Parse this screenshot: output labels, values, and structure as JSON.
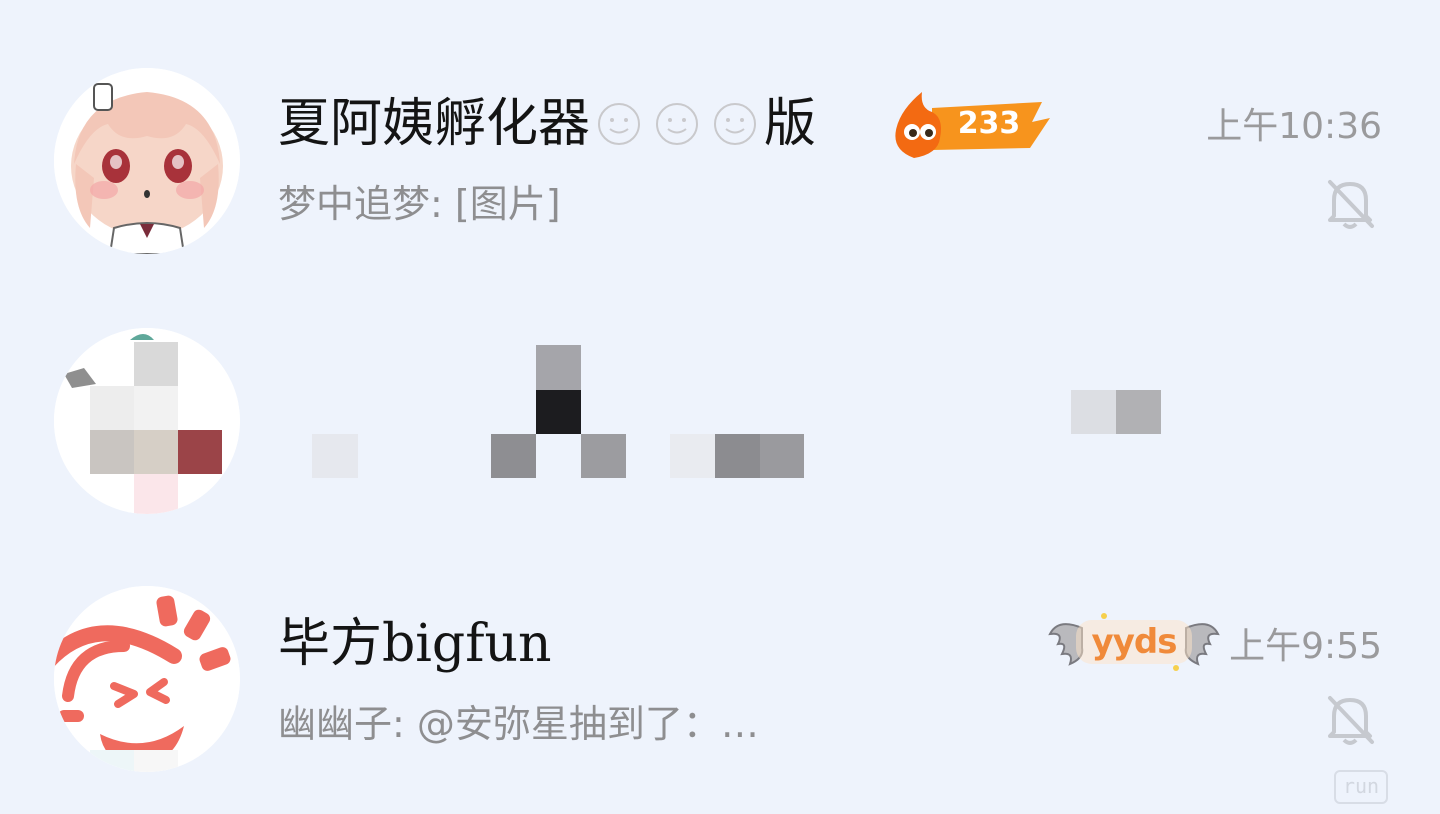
{
  "conversations": [
    {
      "name_prefix": "夏阿姨孵化器",
      "name_emojis": [
        "smile-face-icon",
        "smile-face-icon",
        "smile-face-icon"
      ],
      "name_suffix": "版",
      "fire_badge": {
        "count": "233",
        "color": "#f7941d"
      },
      "time": "上午10:36",
      "preview": "梦中追梦: [图片]",
      "muted": true
    },
    {
      "name": "",
      "preview": "",
      "time": "",
      "pixelated": true
    },
    {
      "name": "毕方bigfun",
      "badge": {
        "text": "yyds"
      },
      "time": "上午9:55",
      "preview": "幽幽子: @安弥星抽到了：…",
      "muted": true
    }
  ],
  "colors": {
    "background": "#eef3fc",
    "name_text": "#141414",
    "preview_text": "#8e8e90",
    "time_text": "#9a9a9c",
    "bigfun_avatar": "#ef6a5e"
  },
  "watermark": {
    "text": "run"
  }
}
